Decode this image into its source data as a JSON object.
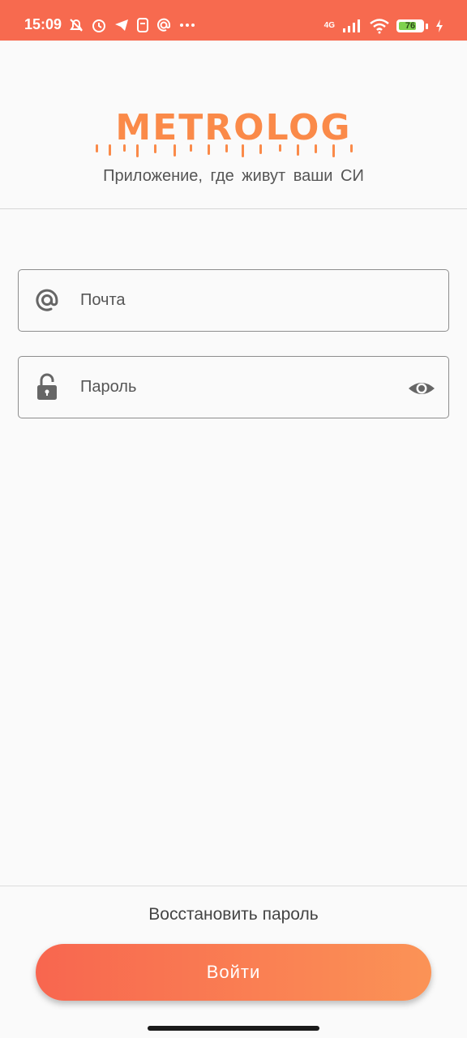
{
  "status_bar": {
    "time": "15:09",
    "network": "4G",
    "battery": "76",
    "battery_level": 0.76,
    "icons": [
      "bell-off-icon",
      "alarm-icon",
      "telegram-icon",
      "sim-icon",
      "at-icon",
      "more-icon",
      "signal-icon",
      "wifi-icon",
      "charging-icon"
    ]
  },
  "header": {
    "logo_text": "METROLOG",
    "tagline": "Приложение, где живут ваши СИ"
  },
  "form": {
    "email_placeholder": "Почта",
    "password_placeholder": "Пароль"
  },
  "footer": {
    "recover_label": "Восстановить пароль",
    "login_label": "Войти"
  },
  "colors": {
    "accent": "#fa8a49",
    "status_bar": "#f76a4f",
    "button_start": "#f8664f",
    "button_end": "#fb9356"
  }
}
